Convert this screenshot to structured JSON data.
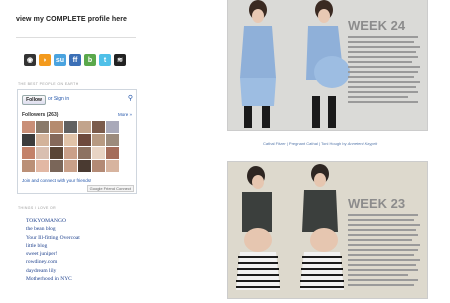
{
  "sidebar": {
    "profile_link": "view my COMPLETE profile here",
    "social_icons": [
      "camera-icon",
      "rss-icon",
      "stumbleupon-icon",
      "friendfeed-icon",
      "blogger-icon",
      "twitter-icon",
      "feed-icon"
    ],
    "networked_heading": "THE BEST PEOPLE ON EARTH",
    "gfc": {
      "follow_label": "Follow",
      "signin_label": "or Sign in",
      "followers_label": "Followers (263)",
      "view_all": "More »",
      "join_link": "Join and connect with your friends!",
      "footer": "Google Friend Connect"
    },
    "links_heading": "THINGS I LOVE OR",
    "links": [
      "TOKYOMANGO",
      "the bean blog",
      "Your Ill-fitting Overcoat",
      "little blog",
      "sweet juniper!",
      "rowdiney.com",
      "daydream lily",
      "Motherhood in NYC"
    ]
  },
  "main": {
    "post1": {
      "title": "WEEK 24",
      "caption_a": "Cathal Fitzer | Pregnant Cathal | Toni Hough by ",
      "caption_b": "Anneteni Kayprit"
    },
    "post2": {
      "title": "WEEK 23"
    }
  },
  "colors": {
    "link": "#1c3f8c",
    "photo_bg1": "#d9d9d7",
    "photo_bg2": "#dcd8cc"
  }
}
